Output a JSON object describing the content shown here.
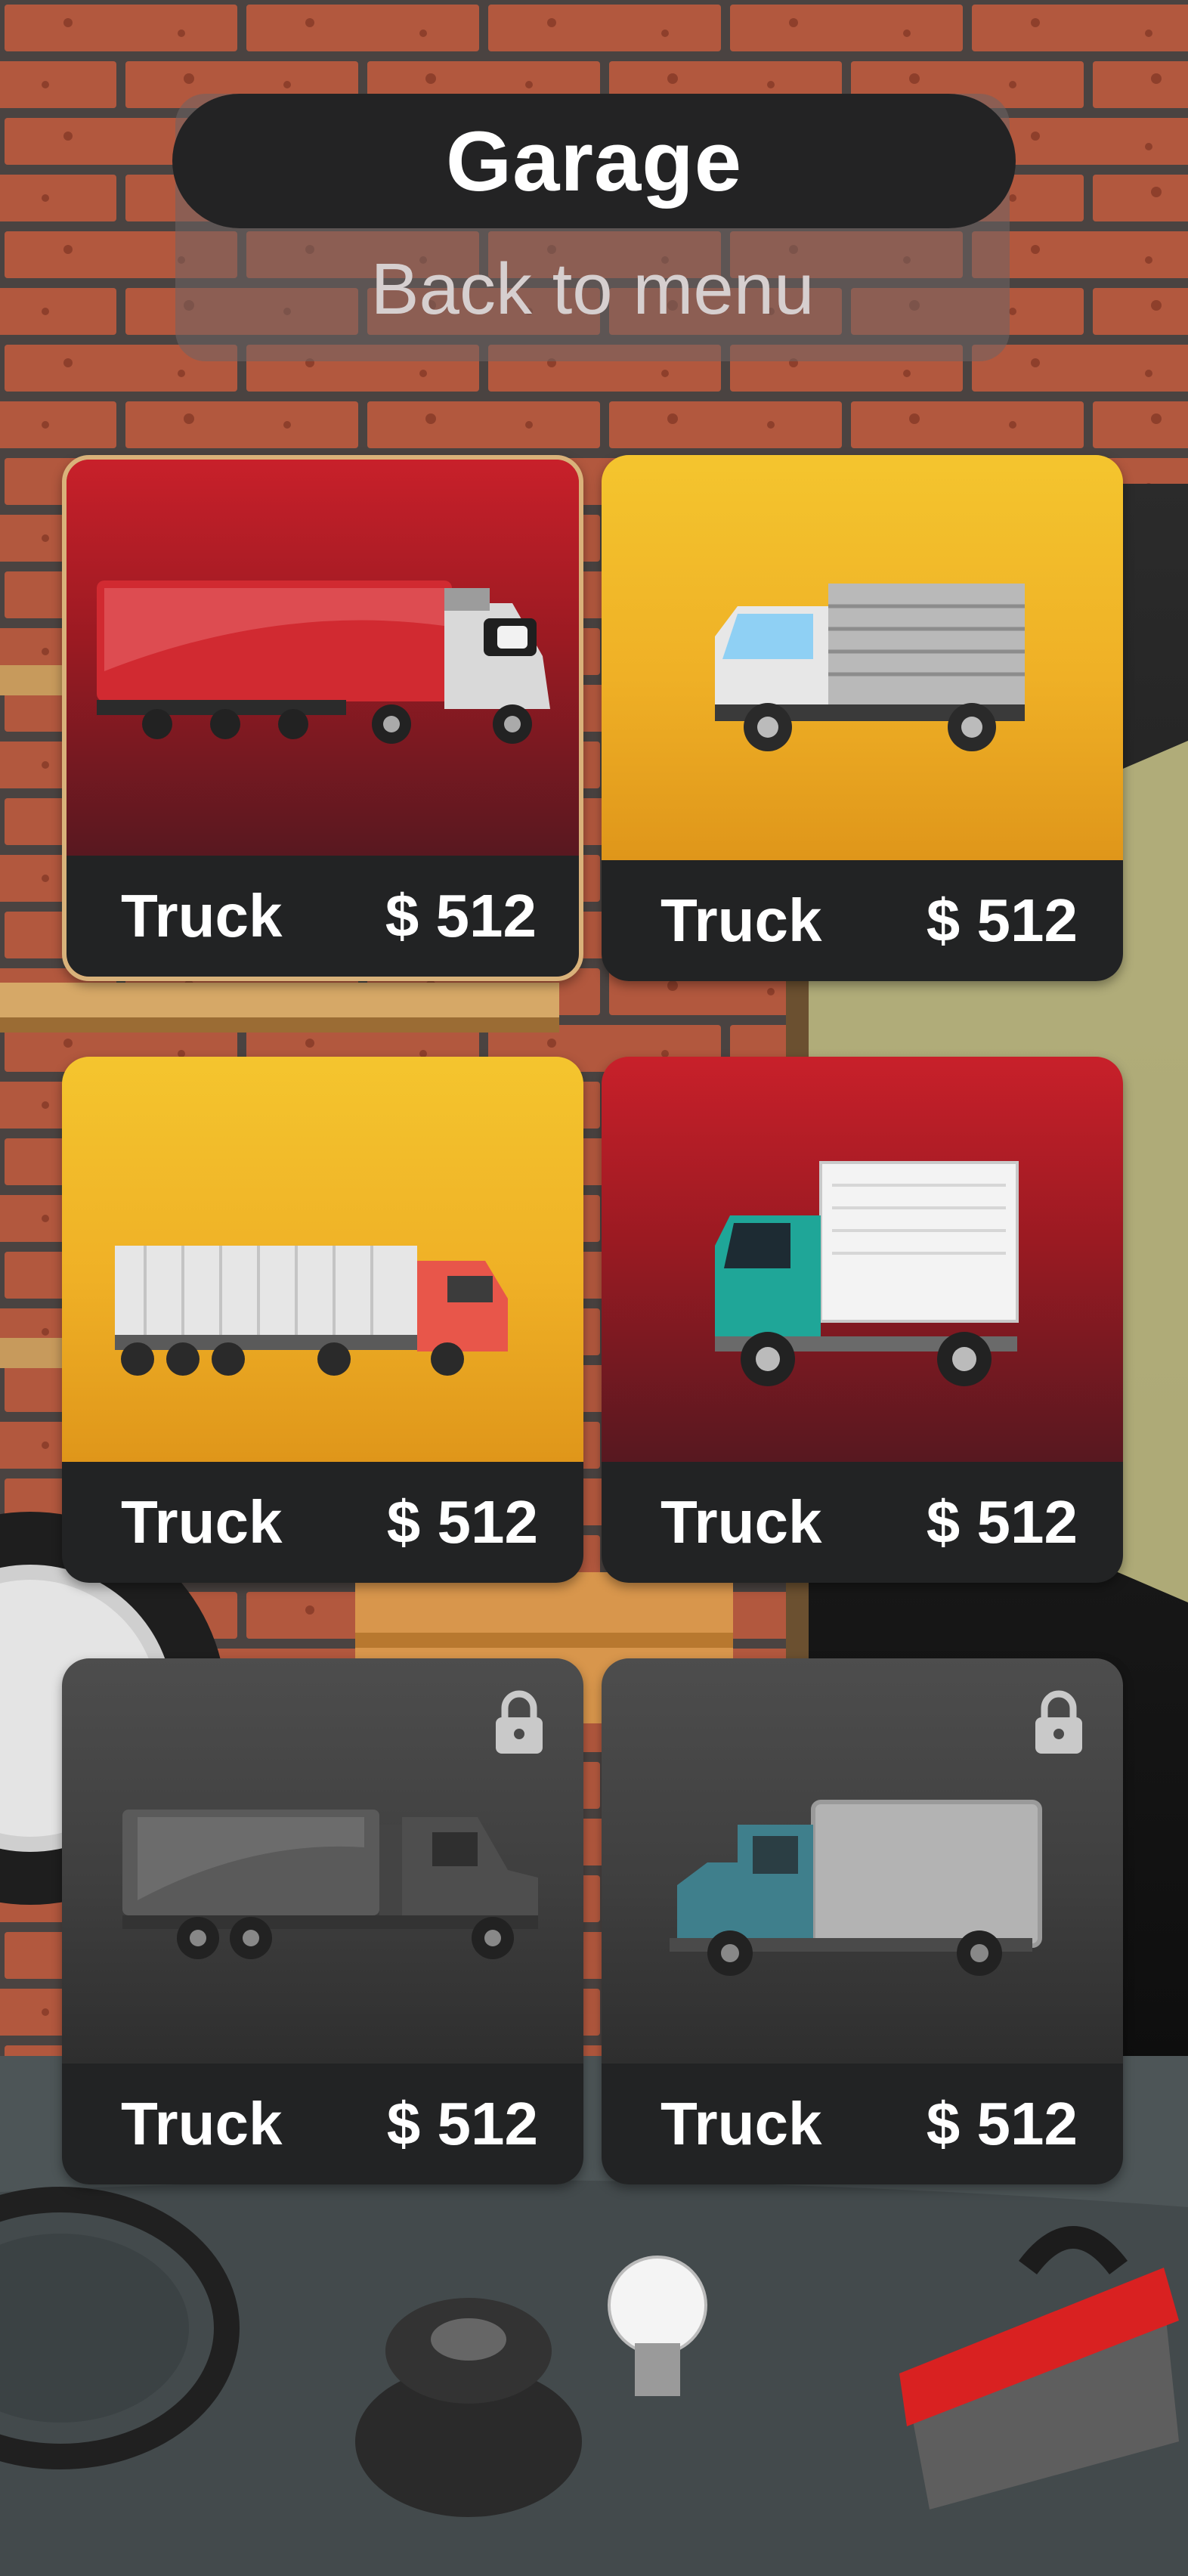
{
  "header": {
    "title": "Garage",
    "back_label": "Back to menu"
  },
  "cards": [
    {
      "name": "Truck",
      "price": "$ 512",
      "theme": "red",
      "selected": true,
      "locked": false
    },
    {
      "name": "Truck",
      "price": "$ 512",
      "theme": "yellow",
      "selected": false,
      "locked": false
    },
    {
      "name": "Truck",
      "price": "$ 512",
      "theme": "yellow",
      "selected": false,
      "locked": false
    },
    {
      "name": "Truck",
      "price": "$ 512",
      "theme": "red",
      "selected": false,
      "locked": false
    },
    {
      "name": "Truck",
      "price": "$ 512",
      "theme": "gray",
      "selected": false,
      "locked": true
    },
    {
      "name": "Truck",
      "price": "$ 512",
      "theme": "gray",
      "selected": false,
      "locked": true
    }
  ],
  "colors": {
    "accent_gold": "#d9b27a",
    "card_red": "#c8202a",
    "card_yellow": "#f4c52e",
    "panel_dark": "#222324"
  }
}
